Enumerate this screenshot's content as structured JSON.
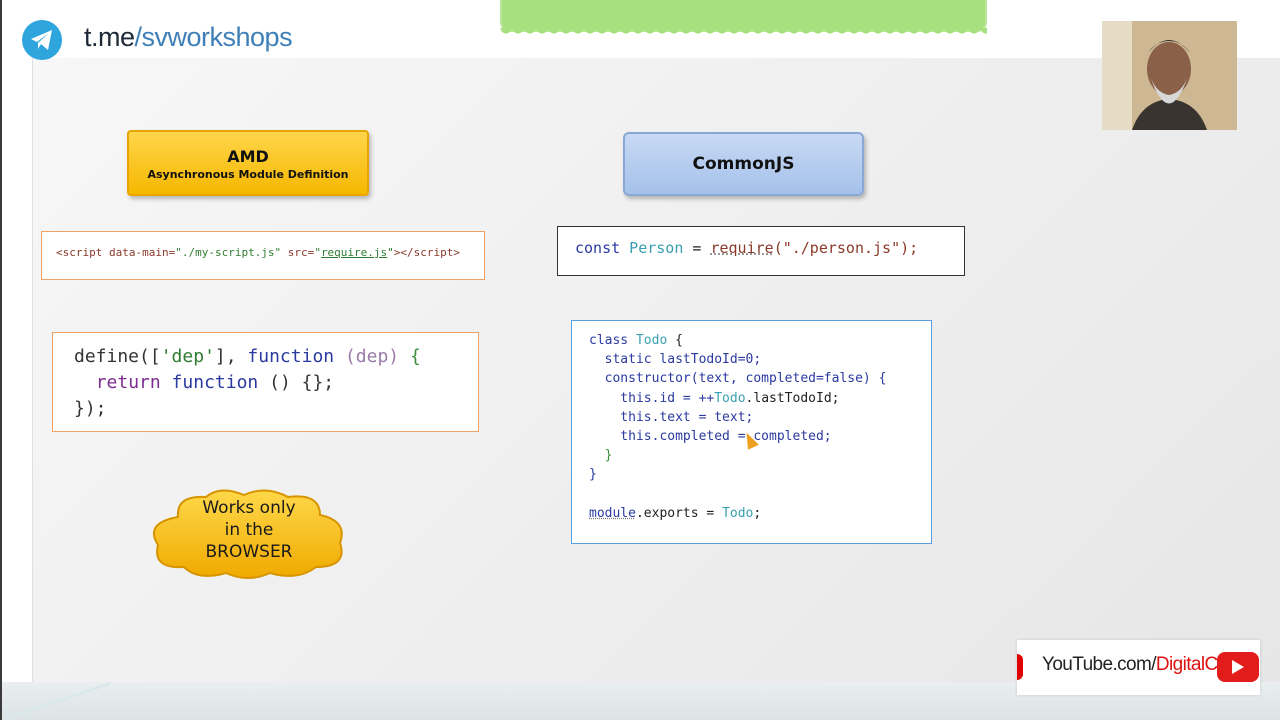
{
  "header": {
    "telegram_host": "t.me",
    "telegram_path": "/svworkshops"
  },
  "amd": {
    "title": "AMD",
    "subtitle": "Asynchronous Module Definition",
    "script_tag": {
      "open": "<script data-main=",
      "data_main": "\"./my-script.js\"",
      "src_attr": " src=",
      "src_q1": "\"",
      "src_value": "require.js",
      "src_q2": "\"",
      "close": "></script>"
    },
    "define_code": {
      "line1_fn": "define",
      "line1_open": "([",
      "line1_dep": "'dep'",
      "line1_mid": "], ",
      "line1_kw": "function",
      "line1_param": " (dep)",
      "line1_brace": " {",
      "line2_kw": "return",
      "line2_kw2": " function",
      "line2_rest": " () {};",
      "line3": "});"
    },
    "note": [
      "Works only",
      "in the",
      "BROWSER"
    ]
  },
  "commonjs": {
    "title": "CommonJS",
    "require_code": {
      "kw": "const",
      "name": " Person",
      "eq": " = ",
      "fn": "require",
      "arg": "(\"./person.js\");"
    },
    "todo_code": {
      "l1_kw": "class",
      "l1_name": " Todo",
      "l1_brace": " {",
      "l2": "  static lastTodoId=0;",
      "l3": "  constructor(text, completed=false) {",
      "l4_a": "    this.id = ++",
      "l4_b": "Todo",
      "l4_c": ".lastTodoId;",
      "l5": "    this.text = text;",
      "l6": "    this.completed = completed;",
      "l7": "  }",
      "l8": "}",
      "l9_a": "module",
      "l9_b": ".exports = ",
      "l9_c": "Todo",
      "l9_d": ";"
    }
  },
  "youtube": {
    "host": "YouTube.com/",
    "channel": "DigitalCV"
  },
  "colors": {
    "telegram": "#2ea6dd",
    "amd_header": "#f5b800",
    "commonjs_header": "#a5c1ea",
    "banner": "#a7e07e",
    "youtube_red": "#e21b1b"
  }
}
